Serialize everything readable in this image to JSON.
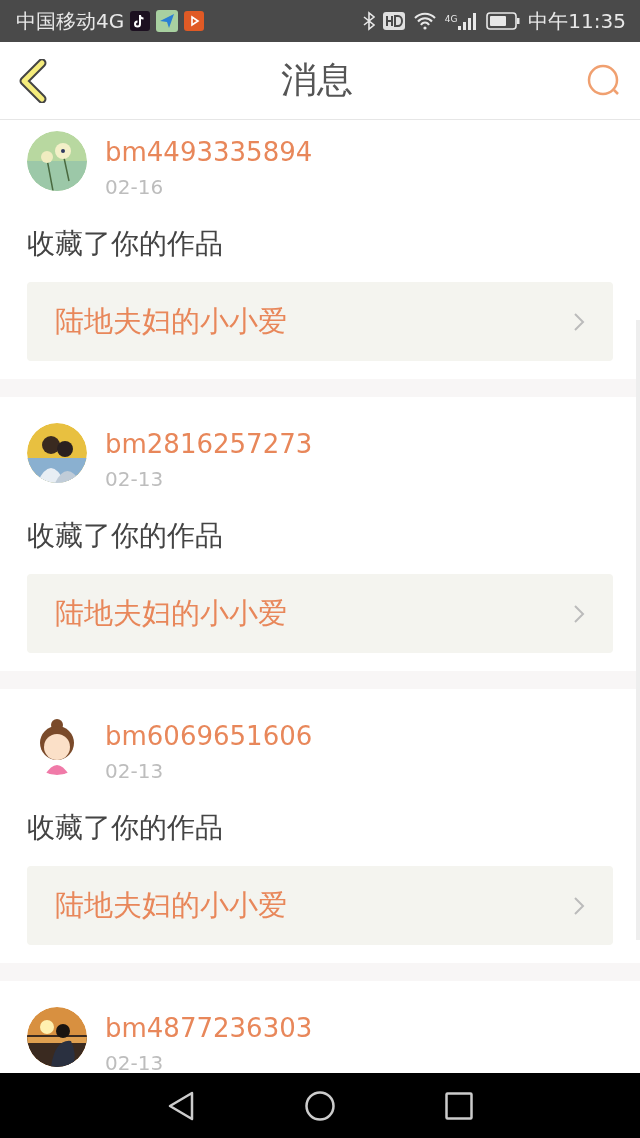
{
  "status_bar": {
    "carrier": "中国移动4G",
    "signal_label": "4G",
    "time": "中午11:35"
  },
  "header": {
    "title": "消息"
  },
  "messages": [
    {
      "user": "bm4493335894",
      "date": "02-16",
      "action": "收藏了你的作品",
      "work": "陆地夫妇的小小爱"
    },
    {
      "user": "bm2816257273",
      "date": "02-13",
      "action": "收藏了你的作品",
      "work": "陆地夫妇的小小爱"
    },
    {
      "user": "bm6069651606",
      "date": "02-13",
      "action": "收藏了你的作品",
      "work": "陆地夫妇的小小爱"
    },
    {
      "user": "bm4877236303",
      "date": "02-13"
    }
  ]
}
